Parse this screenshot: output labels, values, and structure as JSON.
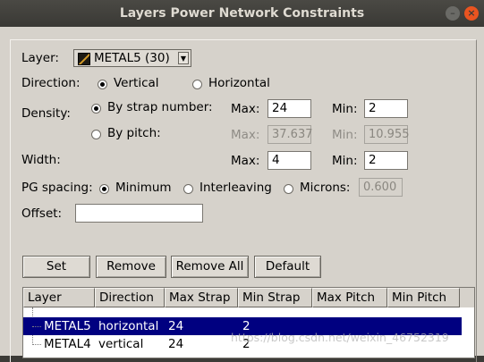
{
  "window": {
    "title": "Layers Power Network Constraints"
  },
  "layer": {
    "label": "Layer:",
    "value": "METAL5 (30)"
  },
  "direction": {
    "label": "Direction:",
    "options": [
      "Vertical",
      "Horizontal"
    ],
    "selected": "Vertical"
  },
  "density": {
    "label": "Density:",
    "by_strap": {
      "label": "By strap number:",
      "selected": true,
      "max_label": "Max:",
      "max": "24",
      "min_label": "Min:",
      "min": "2"
    },
    "by_pitch": {
      "label": "By pitch:",
      "selected": false,
      "max_label": "Max:",
      "max": "37.637",
      "min_label": "Min:",
      "min": "10.955"
    }
  },
  "width": {
    "label": "Width:",
    "max_label": "Max:",
    "max": "4",
    "min_label": "Min:",
    "min": "2"
  },
  "pg_spacing": {
    "label": "PG spacing:",
    "options": [
      "Minimum",
      "Interleaving",
      "Microns:"
    ],
    "selected": "Minimum",
    "microns": "0.600"
  },
  "offset": {
    "label": "Offset:",
    "value": ""
  },
  "buttons": {
    "set": "Set",
    "remove": "Remove",
    "remove_all": "Remove All",
    "default": "Default"
  },
  "table": {
    "columns": [
      "Layer",
      "Direction",
      "Max Strap",
      "Min Strap",
      "Max Pitch",
      "Min Pitch"
    ],
    "rows": [
      {
        "layer": "METAL5",
        "direction": "horizontal",
        "max_strap": "24",
        "min_strap": "2",
        "max_pitch": "",
        "min_pitch": "",
        "selected": true
      },
      {
        "layer": "METAL4",
        "direction": "vertical",
        "max_strap": "24",
        "min_strap": "2",
        "max_pitch": "",
        "min_pitch": "",
        "selected": false
      }
    ]
  },
  "watermark": "https://blog.csdn.net/weixin_46752319"
}
